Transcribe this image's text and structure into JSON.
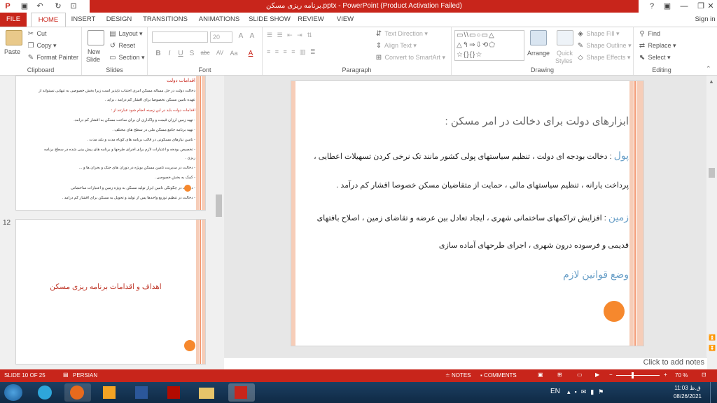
{
  "window": {
    "title": "برنامه ریزی مسکن.pptx - PowerPoint (Product Activation Failed)",
    "controls": [
      "?",
      "▣",
      "—",
      "❐",
      "✕"
    ],
    "sign_in": "Sign in"
  },
  "tabs": [
    "FILE",
    "HOME",
    "INSERT",
    "DESIGN",
    "TRANSITIONS",
    "ANIMATIONS",
    "SLIDE SHOW",
    "REVIEW",
    "VIEW"
  ],
  "active_tab": "HOME",
  "ribbon": {
    "clipboard": {
      "label": "Clipboard",
      "paste": "Paste",
      "cut": "Cut",
      "copy": "Copy",
      "format_painter": "Format Painter"
    },
    "slides": {
      "label": "Slides",
      "new_slide": "New",
      "new_slide2": "Slide",
      "layout": "Layout",
      "reset": "Reset",
      "section": "Section"
    },
    "font": {
      "label": "Font",
      "font_name": "",
      "font_size": "20",
      "bold": "B",
      "italic": "I",
      "underline": "U",
      "shadow": "S",
      "strike": "abc",
      "spacing": "AV",
      "case": "Aa",
      "clear": "A",
      "color": "A"
    },
    "paragraph": {
      "label": "Paragraph",
      "text_direction": "Text Direction",
      "align_text": "Align Text",
      "convert": "Convert to SmartArt"
    },
    "drawing": {
      "label": "Drawing",
      "arrange": "Arrange",
      "quick_styles": "Quick",
      "quick_styles2": "Styles",
      "shape_fill": "Shape Fill",
      "shape_outline": "Shape Outline",
      "shape_effects": "Shape Effects"
    },
    "editing": {
      "label": "Editing",
      "find": "Find",
      "replace": "Replace",
      "select": "Select"
    }
  },
  "thumbnails": {
    "slide11": {
      "title": "اقدامات دولت",
      "lines": [
        "دخالت دولت در حل مسأله مسکن امری اجتناب ناپذیر است زیرا بخش خصوصی به تنهایی نمیتواند از",
        "عهده تأمین مسکن نخصوصا برای اقشار کم درآمد ، برآید .",
        "اقدامات دولت باید در این زمینه انجام شود عبارتند از :",
        "- تهیه زمین ارزان قیمت و واگذاری آن برای ساخت مسکن به اقشار کم درآمد.",
        "- تهیه برنامه جامع مسکن ملی در سطح های مختلف .",
        "- تأمین نیازهای مسکونی در قالب برنامه های کوتاه مدت و بلند مدت .",
        "- تخصیص بودجه و اعتبارات لازم برای اجرای طرحها و برنامه های پیش بینی شده در سطح برنامه",
        "ریزی .",
        "- دخالت در مدیریت تأمین مسکن بویژه در دوران های جنگ و بحران ها و ...",
        "- کمک به بخش خصوصی .",
        "- دخالت در چگونگی تأمین ابزار تولید مسکن به ویژه زمین و اعتبارات ساختمانی",
        "- دخالت در تنظیم توزیع واحدها پس از تولید و تحویل به مسکن برای اقشار کم درآمد ."
      ],
      "highlight_line": "اقدامات دولت باید در این زمینه انجام شود عبارتند از :"
    },
    "slide12_number": "12",
    "slide12_title": "اهداف و اقدامات برنامه ریزی مسکن"
  },
  "slide": {
    "heading": "ابزارهای دولت برای دخالت در امر مسکن :",
    "money_label": "پول",
    "money_text1": "دخالت بودجه ای دولت ، تنظیم سیاستهای پولی کشور مانند تک نرخی کردن تسهیلات اعطایی ،",
    "money_text2": "پرداخت یارانه ، تنظیم سیاستهای مالی ، حمایت از متقاضیان مسکن خصوصا اقشار کم درآمد .",
    "land_label": "زمین",
    "land_text1": "افزایش تراکمهای ساختمانی شهری ، ایجاد تعادل بین عرضه و تقاضای زمین ، اصلاح بافتهای",
    "land_text2": "قدیمی و فرسوده درون شهری ، اجرای طرحهای آماده سازی",
    "laws_label": "وضع قوانین لازم"
  },
  "notes_placeholder": "Click to add notes",
  "status": {
    "slide_info": "SLIDE 10 OF 25",
    "language": "PERSIAN",
    "notes": "NOTES",
    "comments": "COMMENTS",
    "zoom": "70 %",
    "zoom_level": 0.7
  },
  "taskbar": {
    "lang": "EN",
    "time": "11:03 ق.ظ",
    "date": "08/26/2021"
  },
  "colors": {
    "accent": "#c8251b",
    "slide_label": "#6aa0c8",
    "orange_dot": "#f6882d",
    "strip": "#f6cdb8"
  }
}
